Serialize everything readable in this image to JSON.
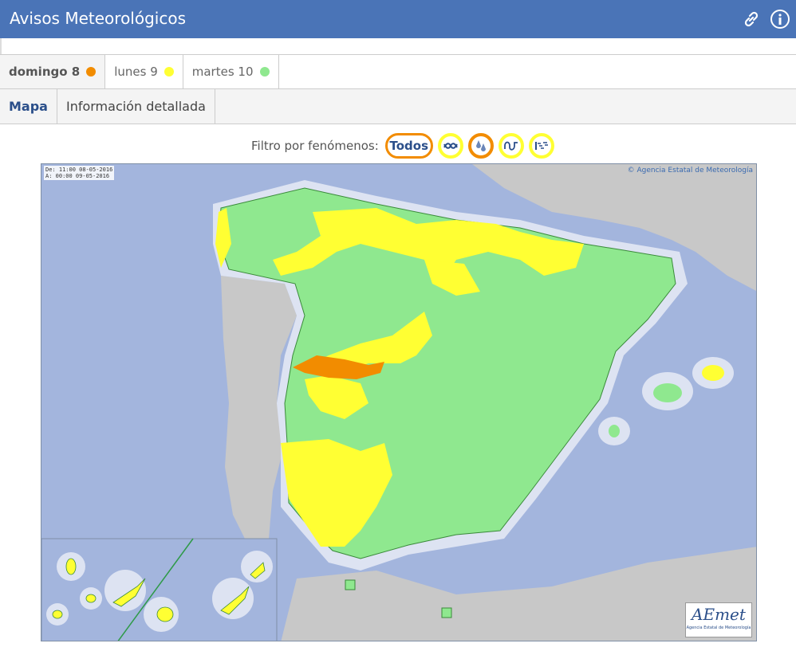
{
  "header": {
    "title": "Avisos Meteorológicos",
    "link_icon": "link-icon",
    "info_icon": "info-icon",
    "bg": "#4a74b7"
  },
  "days": [
    {
      "label": "domingo 8",
      "color": "#f28c00"
    },
    {
      "label": "lunes 9",
      "color": "#ffff33"
    },
    {
      "label": "martes 10",
      "color": "#8fe88f"
    }
  ],
  "subtabs": [
    "Mapa",
    "Información detallada"
  ],
  "filter": {
    "label": "Filtro por fenómenos:",
    "todos": "Todos",
    "icons": [
      "coastal-waves-icon",
      "rain-icon",
      "temperature-icon",
      "wind-icon"
    ]
  },
  "map": {
    "stamp_line1": "De: 11:00 08-05-2016",
    "stamp_line2": "A:  00:00 09-05-2016",
    "credit": "© Agencia Estatal de Meteorología",
    "logo_text": "AEmet",
    "logo_sub": "Agencia Estatal de Meteorología",
    "colors": {
      "sea": "#a3b5dd",
      "land": "#c8c8c8",
      "green": "#8fe88f",
      "yellow": "#ffff33",
      "orange": "#f28c00",
      "coast": "#dde3f2"
    }
  }
}
